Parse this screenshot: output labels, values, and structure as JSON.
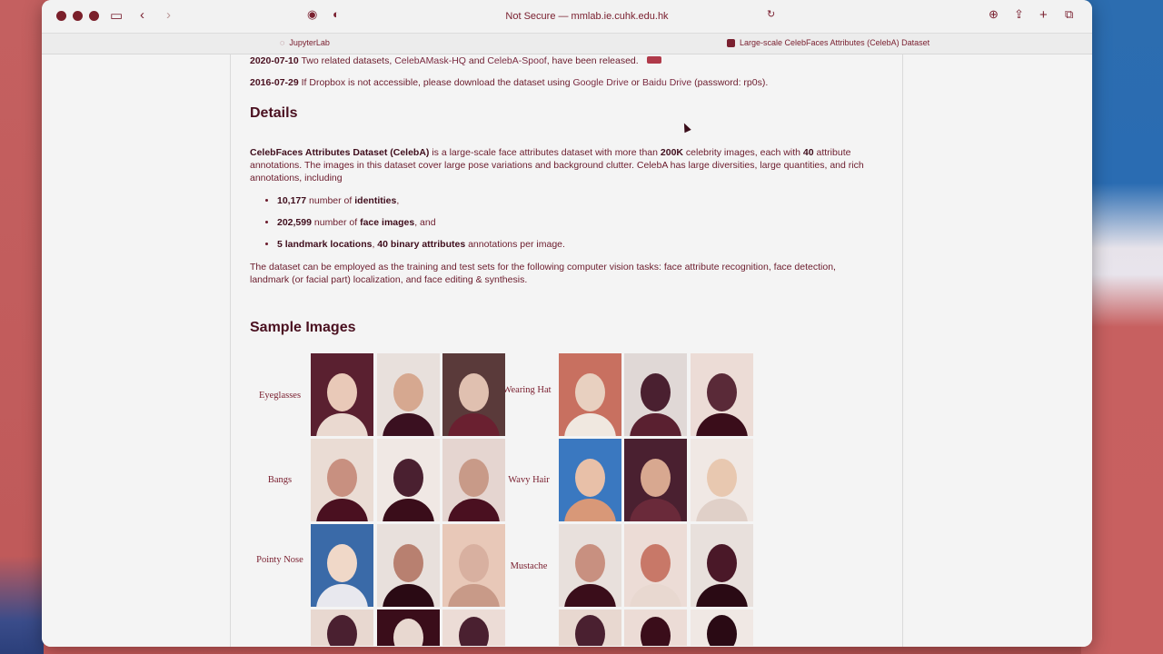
{
  "browser": {
    "url_text": "Not Secure — mmlab.ie.cuhk.edu.hk",
    "tabs": [
      {
        "label": "JupyterLab"
      },
      {
        "label": "Large-scale CelebFaces Attributes (CelebA) Dataset"
      }
    ]
  },
  "news": [
    {
      "date": "2020-07-10",
      "text_before": "Two related datasets, ",
      "link1": "CelebAMask-HQ",
      "text_mid": " and ",
      "link2": "CelebA-Spoof",
      "text_after": ", have been released."
    },
    {
      "date": "2016-07-29",
      "text_before": "If Dropbox is not accessible, please download the dataset using ",
      "link1": "Google Drive",
      "text_mid": " or ",
      "link2": "Baidu Drive",
      "text_after": " (password: rp0s)."
    }
  ],
  "details": {
    "heading": "Details",
    "intro_bold": "CelebFaces Attributes Dataset (CelebA)",
    "intro_1": " is a large-scale face attributes dataset with more than ",
    "intro_bold2": "200K",
    "intro_2": " celebrity images, each with ",
    "intro_bold3": "40",
    "intro_3": " attribute annotations. The images in this dataset cover large pose variations and background clutter. CelebA has large diversities, large quantities, and rich annotations, including",
    "bullets": [
      {
        "bold": "10,177",
        "text": " number of ",
        "bold2": "identities",
        "tail": ","
      },
      {
        "bold": "202,599",
        "text": " number of ",
        "bold2": "face images",
        "tail": ", and"
      },
      {
        "bold": "5 landmark locations",
        "text": ", ",
        "bold2": "40 binary attributes",
        "tail": " annotations per image."
      }
    ],
    "closing": "The dataset can be employed as the training and test sets for the following computer vision tasks: face attribute recognition, face detection, landmark (or facial part) localization, and face editing & synthesis."
  },
  "samples": {
    "heading": "Sample Images",
    "left_labels": [
      "Eyeglasses",
      "Bangs",
      "Pointy Nose"
    ],
    "right_labels": [
      "Wearing Hat",
      "Wavy Hair",
      "Mustache"
    ]
  },
  "colors": {
    "text": "#6b1b2c",
    "heading": "#4a1020",
    "face": "#e8d4cf",
    "skin_dark": "#4a2030"
  }
}
